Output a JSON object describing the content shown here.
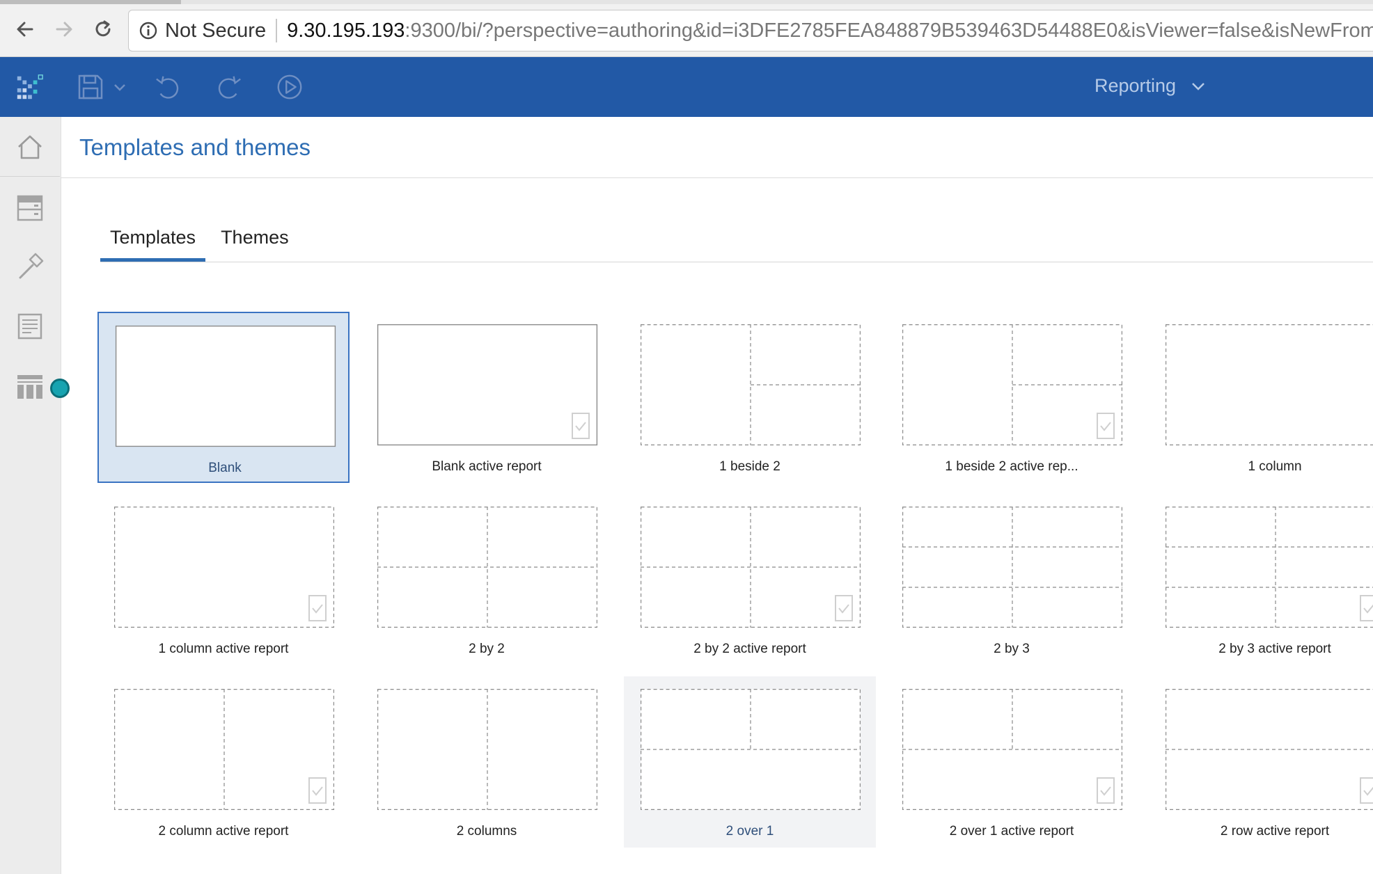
{
  "browser": {
    "security_label": "Not Secure",
    "url_host": "9.30.195.193",
    "url_rest": ":9300/bi/?perspective=authoring&id=i3DFE2785FEA848879B539463D54488E0&isViewer=false&isNewFrom"
  },
  "header": {
    "perspective_label": "Reporting",
    "bg_color": "#2259a6"
  },
  "page": {
    "title": "Templates and themes"
  },
  "tabs": [
    {
      "label": "Templates",
      "active": true
    },
    {
      "label": "Themes",
      "active": false
    }
  ],
  "templates": [
    {
      "label": "Blank",
      "layout": "blank",
      "active_report": false,
      "state": "selected"
    },
    {
      "label": "Blank active report",
      "layout": "blank",
      "active_report": true,
      "state": "normal"
    },
    {
      "label": "1 beside 2",
      "layout": "1-beside-2",
      "active_report": false,
      "state": "normal"
    },
    {
      "label": "1 beside 2 active rep...",
      "layout": "1-beside-2",
      "active_report": true,
      "state": "normal"
    },
    {
      "label": "1 column",
      "layout": "1-column",
      "active_report": false,
      "state": "normal"
    },
    {
      "label": "1 column active report",
      "layout": "1-column",
      "active_report": true,
      "state": "normal"
    },
    {
      "label": "2 by 2",
      "layout": "2-by-2",
      "active_report": false,
      "state": "normal"
    },
    {
      "label": "2 by 2 active report",
      "layout": "2-by-2",
      "active_report": true,
      "state": "normal"
    },
    {
      "label": "2 by 3",
      "layout": "2-by-3",
      "active_report": false,
      "state": "normal"
    },
    {
      "label": "2 by 3 active report",
      "layout": "2-by-3",
      "active_report": true,
      "state": "normal"
    },
    {
      "label": "2 column active report",
      "layout": "2-columns",
      "active_report": true,
      "state": "normal"
    },
    {
      "label": "2 columns",
      "layout": "2-columns",
      "active_report": false,
      "state": "normal"
    },
    {
      "label": "2 over 1",
      "layout": "2-over-1",
      "active_report": false,
      "state": "hovered"
    },
    {
      "label": "2 over 1 active report",
      "layout": "2-over-1",
      "active_report": true,
      "state": "normal"
    },
    {
      "label": "2 row active report",
      "layout": "2-rows",
      "active_report": true,
      "state": "normal"
    }
  ]
}
